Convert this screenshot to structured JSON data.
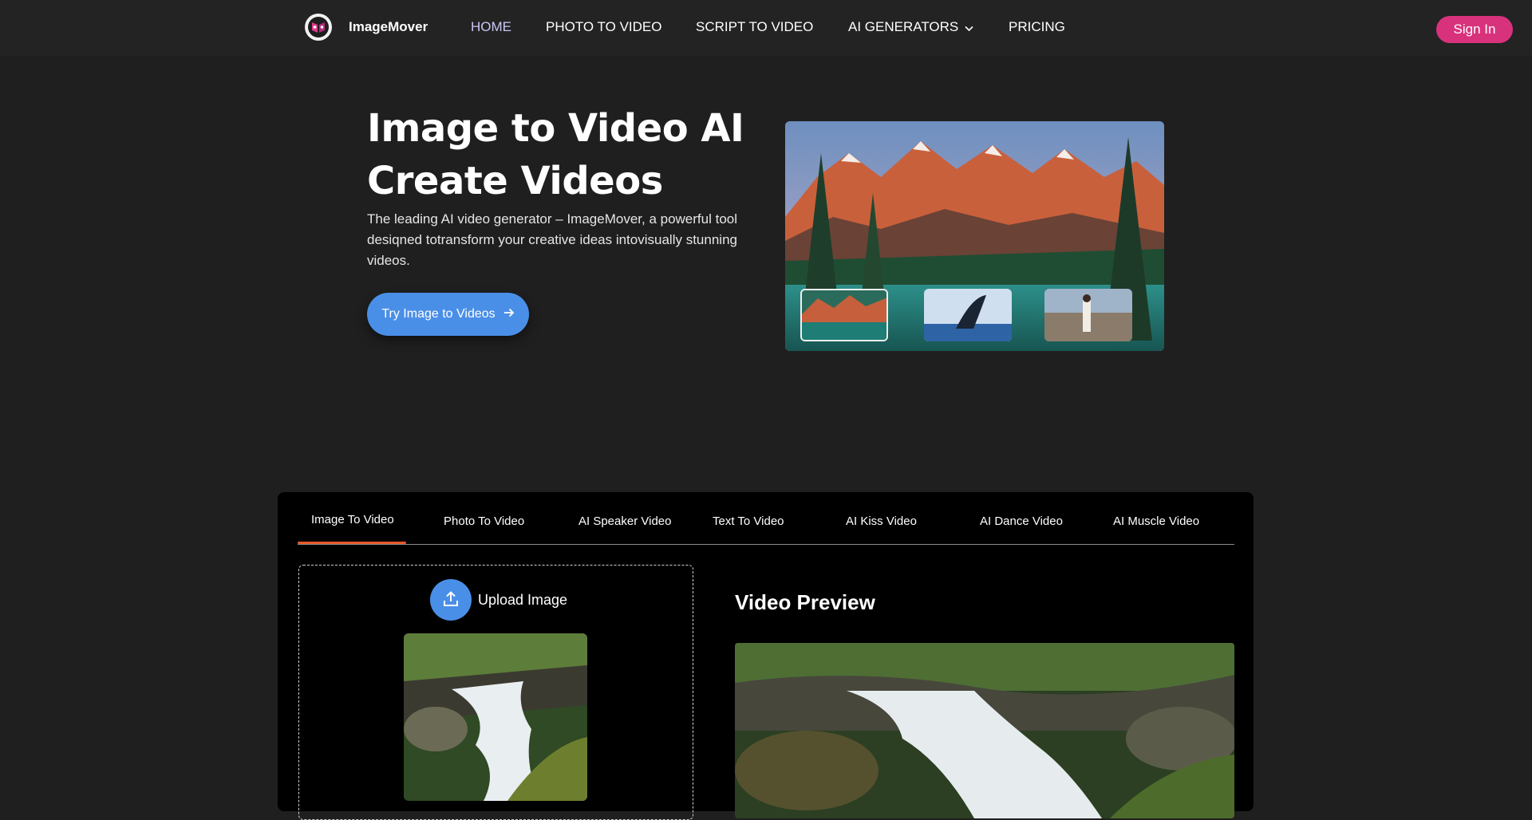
{
  "nav": {
    "brand": "ImageMover",
    "links": [
      {
        "label": "HOME",
        "active": true
      },
      {
        "label": "PHOTO TO VIDEO"
      },
      {
        "label": "SCRIPT TO VIDEO"
      },
      {
        "label": "AI GENERATORS"
      },
      {
        "label": "PRICING"
      }
    ],
    "signin": "Sign In"
  },
  "hero": {
    "title_line1": "Image to Video AI",
    "title_line2": "Create Videos",
    "description": "The leading AI video generator – ImageMover, a powerful tool desiqned totransform your creative ideas intovisually stunning videos.",
    "cta": "Try Image to Videos"
  },
  "tool": {
    "tabs": [
      "Image To Video",
      "Photo To Video",
      "AI Speaker Video",
      "Text To Video",
      "AI Kiss Video",
      "AI Dance Video",
      "AI Muscle Video"
    ],
    "upload_label": "Upload Image",
    "preview_title": "Video Preview"
  },
  "colors": {
    "background": "#1f1f1f",
    "accent_blue": "#4a8fe7",
    "signin_pink": "#d9327c",
    "tab_underline": "#e8572a"
  }
}
